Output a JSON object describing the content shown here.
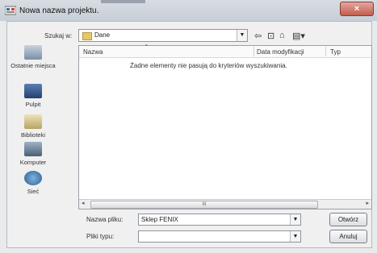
{
  "window": {
    "title": "Nowa nazwa projektu.",
    "close_label": "×"
  },
  "lookin": {
    "label": "Szukaj w:",
    "value": "Dane"
  },
  "places": [
    {
      "label": "Ostatnie miejsca",
      "icon": "recent-places-icon"
    },
    {
      "label": "Pulpit",
      "icon": "desktop-icon"
    },
    {
      "label": "Biblioteki",
      "icon": "libraries-icon"
    },
    {
      "label": "Komputer",
      "icon": "computer-icon"
    },
    {
      "label": "Sieć",
      "icon": "network-icon"
    }
  ],
  "filelist": {
    "columns": [
      "Nazwa",
      "Data modyfikacji",
      "Typ"
    ],
    "empty_message": "Żadne elementy nie pasują do kryteriów wyszukiwania.",
    "scroll_thumb": "III"
  },
  "filename": {
    "label": "Nazwa pliku:",
    "value": "Sklep FENIX"
  },
  "filetype": {
    "label": "Pliki typu:",
    "value": ""
  },
  "buttons": {
    "open": "Otwórz",
    "cancel": "Anuluj"
  },
  "colors": {
    "titlebar": "#c7ced6",
    "close": "#c45d4e"
  }
}
